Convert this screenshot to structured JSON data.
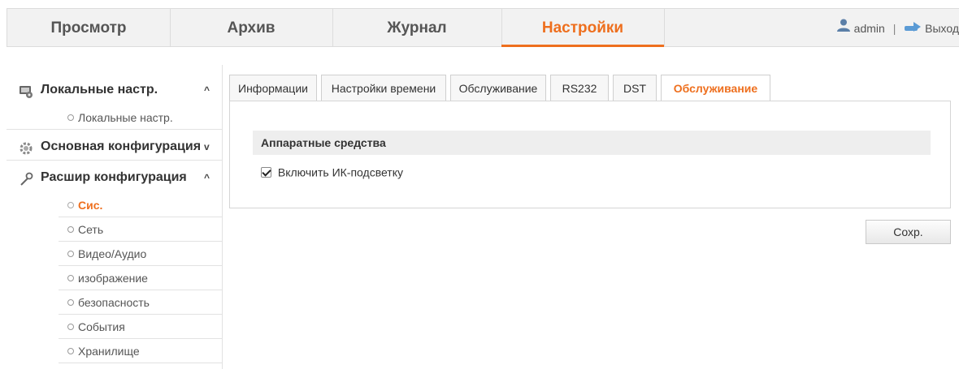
{
  "topnav": {
    "tabs": [
      {
        "label": "Просмотр"
      },
      {
        "label": "Архив"
      },
      {
        "label": "Журнал"
      },
      {
        "label": "Настройки"
      }
    ],
    "active_tab": "Настройки",
    "user": "admin",
    "divider": "|",
    "logout": "Выход"
  },
  "sidebar": {
    "sections": [
      {
        "label": "Локальные настр.",
        "icon": "monitor-settings-icon",
        "chevron": "^"
      },
      {
        "label": "Основная конфигурация",
        "icon": "gear-icon",
        "chevron": "v"
      },
      {
        "label": "Расшир конфигурация",
        "icon": "wrench-icon",
        "chevron": "^"
      }
    ],
    "local_items": [
      "Локальные настр."
    ],
    "advanced_items": [
      "Сис.",
      "Сеть",
      "Видео/Аудио",
      "изображение",
      "безопасность",
      "События",
      "Хранилище"
    ],
    "active_item": "Сис."
  },
  "content": {
    "tabs": [
      "Информации",
      "Настройки времени",
      "Обслуживание",
      "RS232",
      "DST",
      "Обслуживание"
    ],
    "active_tab_index": 5,
    "group_title": "Аппаратные средства",
    "checkbox_label": "Включить ИК-подсветку",
    "checkbox_checked": true,
    "save_label": "Сохр."
  },
  "colors": {
    "accent": "#ee6f1e",
    "nav_bg": "#f2f2f2",
    "group_bg": "#eeeeee"
  }
}
